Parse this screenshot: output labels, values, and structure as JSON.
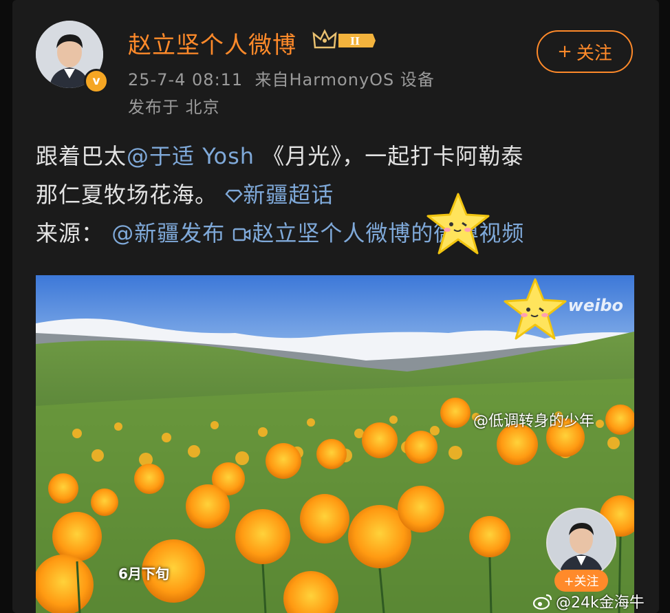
{
  "post": {
    "author": "赵立坚个人微博",
    "level_badge": "II",
    "verified_badge": "v",
    "timestamp": "25-7-4 08:11",
    "source": "来自",
    "device": "HarmonyOS 设备",
    "location": "发布于 北京",
    "follow_label": "关注",
    "follow_plus": "+",
    "line1_pre": "跟着巴太",
    "line1_mention": "@于适 Yosh",
    "line1_post": " 《月光》，一起打卡阿勒泰",
    "line2_pre": "那仁夏牧场花海。",
    "line2_topic": "新疆超话",
    "line3_pre": "来源：",
    "line3_mention": "@新疆发布",
    "line3_video": "赵立坚个人微博的微博视频"
  },
  "media": {
    "watermark_logo": "weibo",
    "user_watermark": "@低调转身的少年",
    "date_tag": "6月下旬",
    "mini_follow": "+关注"
  },
  "footer": {
    "watermark": "@24k金海牛"
  },
  "colors": {
    "accent": "#ff8a2a",
    "link": "#7fa9d9",
    "background": "#1b1b1b"
  }
}
